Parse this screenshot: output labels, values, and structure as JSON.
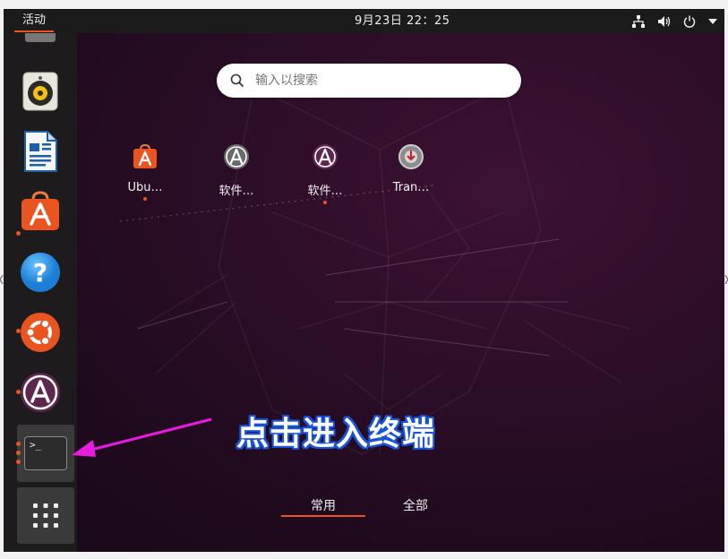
{
  "topbar": {
    "activities_label": "活动",
    "clock": "9月23日  22：25",
    "network_icon": "network-icon",
    "volume_icon": "volume-icon",
    "power_icon": "power-icon",
    "menu_icon": "chevron-down-icon"
  },
  "dock": {
    "items": [
      {
        "name": "rhythmbox",
        "icon": "speaker-icon",
        "running": false
      },
      {
        "name": "libreoffice-writer",
        "icon": "document-icon",
        "running": false
      },
      {
        "name": "ubuntu-software",
        "icon": "software-bag-icon",
        "running": true
      },
      {
        "name": "help",
        "icon": "help-icon",
        "running": false
      },
      {
        "name": "ubuntu",
        "icon": "ubuntu-logo-icon",
        "running": true
      },
      {
        "name": "software-updater",
        "icon": "software-update-icon",
        "running": true
      },
      {
        "name": "terminal",
        "icon": "terminal-icon",
        "running": true
      },
      {
        "name": "show-applications",
        "icon": "app-grid-icon",
        "running": false
      }
    ],
    "terminal_prompt": ">_"
  },
  "search": {
    "placeholder": "输入以搜索"
  },
  "apps": [
    {
      "label": "Ubu…",
      "running": true
    },
    {
      "label": "软件…",
      "running": false
    },
    {
      "label": "软件…",
      "running": true
    },
    {
      "label": "Tran…",
      "running": false
    }
  ],
  "tabs": {
    "frequent": "常用",
    "all": "全部",
    "active": "frequent"
  },
  "annotation": {
    "text": "点击进入终端"
  },
  "colors": {
    "accent": "#e95420",
    "annotation_fill": "#ffffff",
    "annotation_outline": "#1b55d8",
    "arrow": "#e81ce0"
  }
}
